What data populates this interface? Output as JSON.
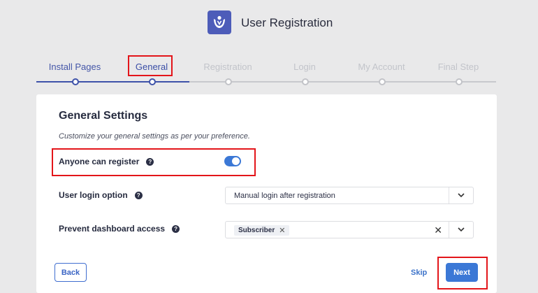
{
  "app": {
    "title": "User Registration",
    "logo_icon": "user-registration-logo-icon"
  },
  "steps": [
    {
      "label": "Install Pages",
      "state": "done"
    },
    {
      "label": "General",
      "state": "active"
    },
    {
      "label": "Registration",
      "state": "pending"
    },
    {
      "label": "Login",
      "state": "pending"
    },
    {
      "label": "My Account",
      "state": "pending"
    },
    {
      "label": "Final Step",
      "state": "pending"
    }
  ],
  "card": {
    "title": "General Settings",
    "subtitle": "Customize your general settings as per your preference.",
    "fields": {
      "anyone_can_register": {
        "label": "Anyone can register",
        "help": "?",
        "enabled": true
      },
      "user_login_option": {
        "label": "User login option",
        "help": "?",
        "value": "Manual login after registration"
      },
      "prevent_dashboard_access": {
        "label": "Prevent dashboard access",
        "help": "?",
        "tags": [
          "Subscriber"
        ]
      }
    }
  },
  "footer": {
    "back_label": "Back",
    "skip_label": "Skip",
    "next_label": "Next"
  },
  "colors": {
    "accent": "#3b78d6",
    "brand": "#4d5cb9",
    "highlight": "#e3151a"
  }
}
